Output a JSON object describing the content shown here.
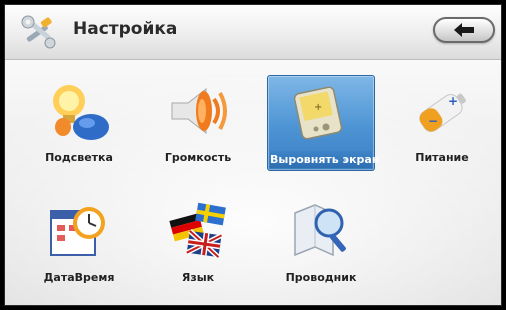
{
  "header": {
    "title": "Настройка",
    "icon": "tools-icon",
    "back_icon": "back-arrow-icon"
  },
  "tiles": [
    {
      "label": "Подсветка",
      "icon": "backlight-bulb-icon",
      "selected": false
    },
    {
      "label": "Громкость",
      "icon": "volume-speaker-icon",
      "selected": false
    },
    {
      "label": "Выровнять экран",
      "icon": "screen-calibration-icon",
      "selected": true
    },
    {
      "label": "Питание",
      "icon": "battery-icon",
      "selected": false
    },
    {
      "label": "ДатаВремя",
      "icon": "date-time-clock-icon",
      "selected": false
    },
    {
      "label": "Язык",
      "icon": "language-flags-icon",
      "selected": false
    },
    {
      "label": "Проводник",
      "icon": "file-explorer-magnifier-icon",
      "selected": false
    }
  ],
  "colors": {
    "selection": "#4d94d4",
    "background": "#f2f2f2"
  }
}
